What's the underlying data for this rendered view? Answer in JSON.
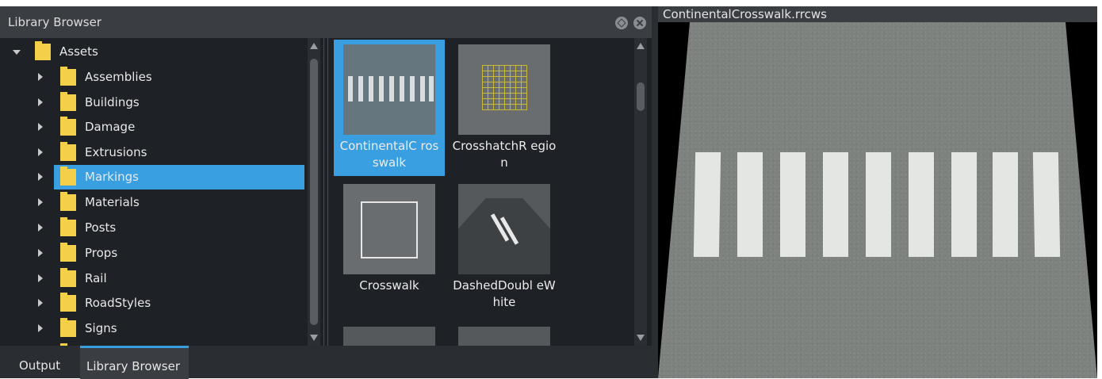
{
  "library_browser": {
    "title": "Library Browser",
    "tree": {
      "root": {
        "label": "Assets",
        "expanded": true
      },
      "items": [
        {
          "label": "Assemblies",
          "selected": false
        },
        {
          "label": "Buildings",
          "selected": false
        },
        {
          "label": "Damage",
          "selected": false
        },
        {
          "label": "Extrusions",
          "selected": false
        },
        {
          "label": "Markings",
          "selected": true
        },
        {
          "label": "Materials",
          "selected": false
        },
        {
          "label": "Posts",
          "selected": false
        },
        {
          "label": "Props",
          "selected": false
        },
        {
          "label": "Rail",
          "selected": false
        },
        {
          "label": "RoadStyles",
          "selected": false
        },
        {
          "label": "Signs",
          "selected": false
        }
      ]
    },
    "assets": [
      {
        "label": "ContinentalC rosswalk",
        "selected": true
      },
      {
        "label": "CrosshatchR egion",
        "selected": false
      },
      {
        "label": "Crosswalk",
        "selected": false
      },
      {
        "label": "DashedDoubl eWhite",
        "selected": false
      }
    ]
  },
  "tabs": [
    {
      "label": "Output",
      "active": false
    },
    {
      "label": "Library Browser",
      "active": true
    }
  ],
  "preview": {
    "title": "ContinentalCrosswalk.rrcws"
  },
  "colors": {
    "accent": "#3a9fe0",
    "folder": "#f3cf4a",
    "panel_bg": "#1e2125",
    "titlebar_bg": "#3a3d42"
  }
}
